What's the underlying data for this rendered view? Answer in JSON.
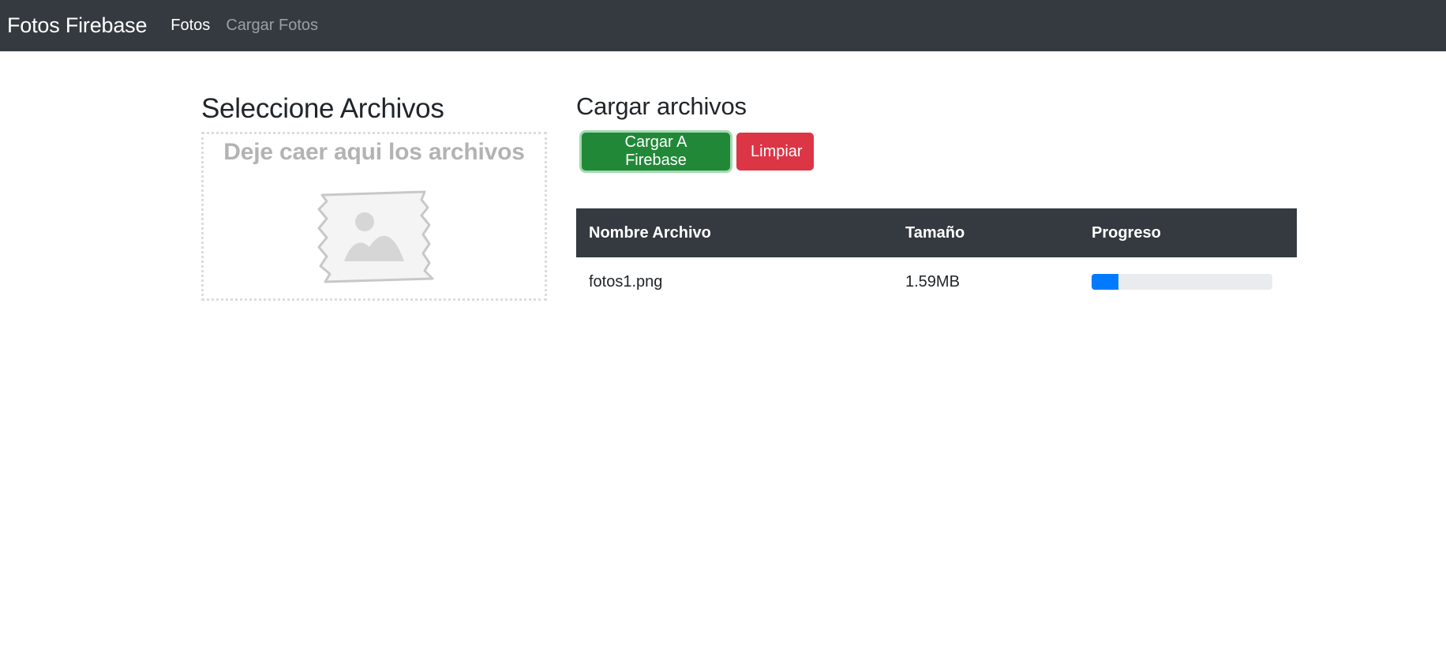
{
  "navbar": {
    "brand": "Fotos Firebase",
    "links": [
      {
        "label": "Fotos",
        "active": true
      },
      {
        "label": "Cargar Fotos",
        "active": false
      }
    ]
  },
  "left": {
    "title": "Seleccione Archivos",
    "dropzone_text": "Deje caer aqui los archivos",
    "icon": "image-placeholder-icon"
  },
  "right": {
    "title": "Cargar archivos",
    "buttons": {
      "upload": "Cargar A Firebase",
      "clear": "Limpiar"
    },
    "table": {
      "headers": [
        "Nombre Archivo",
        "Tamaño",
        "Progreso"
      ],
      "rows": [
        {
          "name": "fotos1.png",
          "size": "1.59MB",
          "progress": 0.15
        }
      ]
    }
  },
  "colors": {
    "navbar_bg": "#343a40",
    "success": "#218838",
    "danger": "#dc3545",
    "progress_fill": "#007bff",
    "progress_track": "#e9ecef"
  }
}
